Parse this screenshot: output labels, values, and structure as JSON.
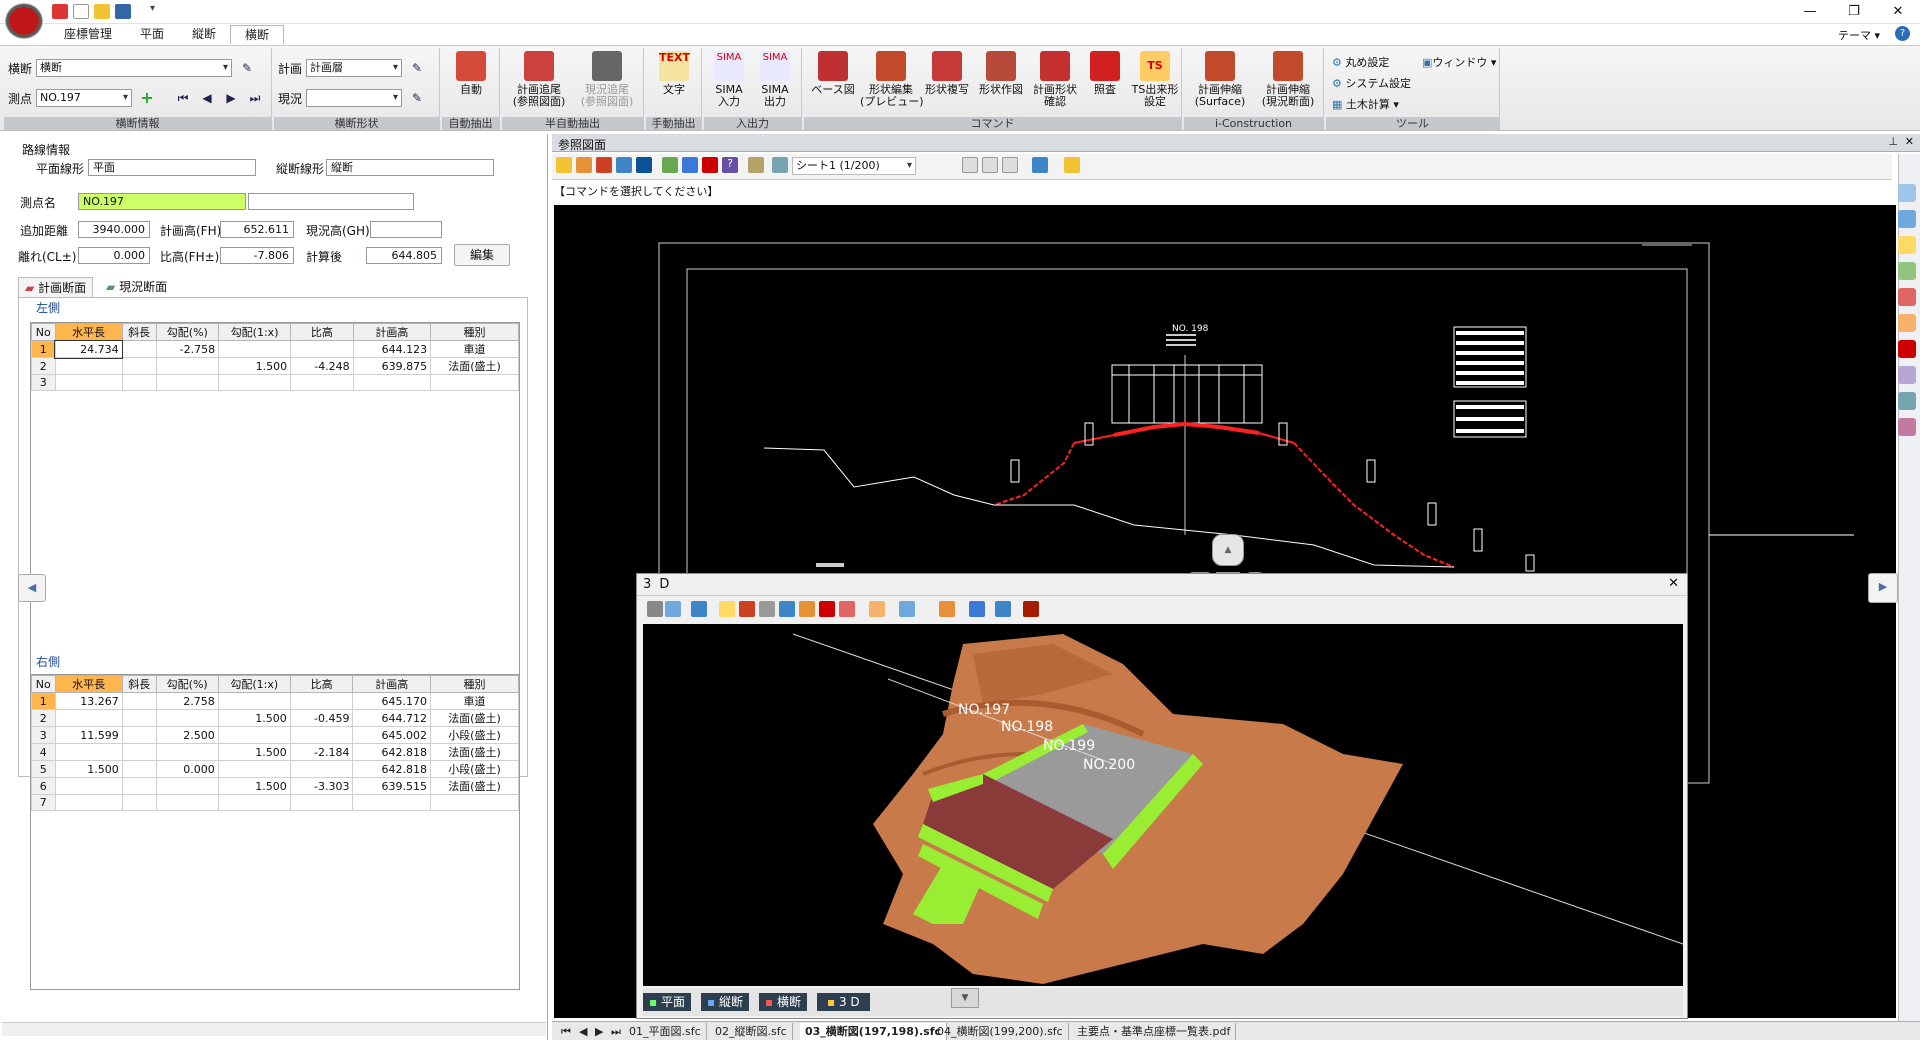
{
  "app": {
    "theme_label": "テーマ",
    "help_label": "?"
  },
  "window": {
    "min": "—",
    "restore": "❐",
    "close": "✕"
  },
  "tabs": [
    "座標管理",
    "平面",
    "縦断",
    "横断"
  ],
  "ribbon": {
    "groups": [
      {
        "caption": "横断情報"
      },
      {
        "caption": "横断形状"
      },
      {
        "caption": "自動抽出"
      },
      {
        "caption": "半自動抽出"
      },
      {
        "caption": "手動抽出"
      },
      {
        "caption": "入出力"
      },
      {
        "caption": "コマンド"
      },
      {
        "caption": "i-Construction"
      },
      {
        "caption": "ツール"
      }
    ],
    "cross_label": "横断",
    "cross_value": "横断",
    "point_label": "測点",
    "point_value": "NO.197",
    "plan_label": "計画",
    "plan_value": "計画層",
    "current_label": "現況",
    "current_value": "",
    "buttons": {
      "auto": "自動",
      "plan_trace": "計画追尾\n(参照図面)",
      "current_trace": "現況追尾\n(参照図面)",
      "text": "文字",
      "text_icon": "TEXT",
      "sima_in": "SIMA\n入力",
      "sima_out": "SIMA\n出力",
      "sima_icon": "SIMA",
      "base": "ベース図",
      "shape_edit": "形状編集\n(プレビュー)",
      "shape_copy": "形状複写",
      "shape_draw": "形状作図",
      "plan_check": "計画形状\n確認",
      "inspect": "照査",
      "ts": "TS出来形\n設定",
      "ts_icon": "TS",
      "stretch_surface": "計画伸縮\n(Surface)",
      "stretch_current": "計画伸縮\n(現況断面)",
      "round": "丸め設定",
      "window": "ウィンドウ",
      "system": "システム設定",
      "earthwork": "土木計算"
    }
  },
  "left": {
    "route_title": "路線情報",
    "plan_shape_label": "平面線形",
    "plan_shape_value": "平面",
    "profile_label": "縦断線形",
    "profile_value": "縦断",
    "point_name_label": "測点名",
    "point_name_value": "NO.197",
    "point_name_extra": "",
    "add_dist_label": "追加距離",
    "add_dist_value": "3940.000",
    "fh_label": "計画高(FH)",
    "fh_value": "652.611",
    "gh_label": "現況高(GH)",
    "gh_value": "",
    "offset_label": "離れ(CL±)",
    "offset_value": "0.000",
    "rel_label": "比高(FH±)",
    "rel_value": "-7.806",
    "calc_label": "計算後",
    "calc_value": "644.805",
    "edit_button": "編集",
    "tab_plan": "計画断面",
    "tab_current": "現況断面",
    "left_side": "左側",
    "right_side": "右側",
    "columns": [
      "No",
      "水平長",
      "斜長",
      "勾配(%)",
      "勾配(1:x)",
      "比高",
      "計画高",
      "種別"
    ],
    "left_rows": [
      [
        "1",
        "24.734",
        "",
        "-2.758",
        "",
        "",
        "644.123",
        "車道"
      ],
      [
        "2",
        "",
        "",
        "",
        "1.500",
        "-4.248",
        "639.875",
        "法面(盛土)"
      ],
      [
        "3",
        "",
        "",
        "",
        "",
        "",
        "",
        ""
      ]
    ],
    "right_rows": [
      [
        "1",
        "13.267",
        "",
        "2.758",
        "",
        "",
        "645.170",
        "車道"
      ],
      [
        "2",
        "",
        "",
        "",
        "1.500",
        "-0.459",
        "644.712",
        "法面(盛土)"
      ],
      [
        "3",
        "11.599",
        "",
        "2.500",
        "",
        "",
        "645.002",
        "小段(盛土)"
      ],
      [
        "4",
        "",
        "",
        "",
        "1.500",
        "-2.184",
        "642.818",
        "法面(盛土)"
      ],
      [
        "5",
        "1.500",
        "",
        "0.000",
        "",
        "",
        "642.818",
        "小段(盛土)"
      ],
      [
        "6",
        "",
        "",
        "",
        "1.500",
        "-3.303",
        "639.515",
        "法面(盛土)"
      ],
      [
        "7",
        "",
        "",
        "",
        "",
        "",
        "",
        ""
      ]
    ]
  },
  "ref": {
    "title": "参照図面",
    "sheet": "シート1 (1/200)",
    "command_prompt": "【コマンドを選択してください】",
    "drawing_title": "NO. 198",
    "threed_title": "3 D",
    "stations": [
      "NO.197",
      "NO.198",
      "NO.199",
      "NO.200"
    ],
    "view_tabs": [
      "平面",
      "縦断",
      "横断",
      "3 D"
    ],
    "file_tabs": [
      "01_平面図.sfc",
      "02_縦断図.sfc",
      "03_横断図(197,198).sfc",
      "04_横断図(199,200).sfc",
      "主要点・基準点座標一覧表.pdf"
    ]
  },
  "colors": {
    "accent": "#ffb74d",
    "field_highlight": "#ccff66",
    "terrain": "#c97a4a",
    "road": "#9a9a9a",
    "slope": "#99ee33",
    "berm": "#8b3a3a",
    "cad_red": "#ff2020"
  }
}
